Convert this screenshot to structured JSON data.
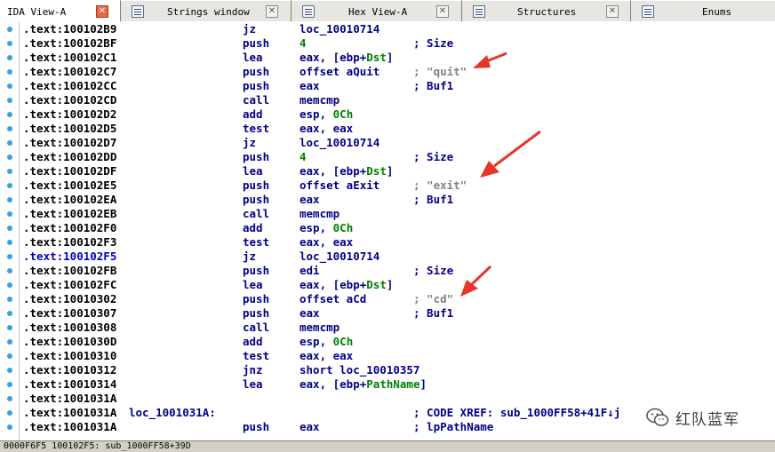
{
  "tabs": [
    {
      "label": "IDA View-A",
      "icon": "listing-icon",
      "active": true
    },
    {
      "label": "Strings window",
      "icon": "strings-icon",
      "active": false
    },
    {
      "label": "Hex View-A",
      "icon": "hex-icon",
      "active": false
    },
    {
      "label": "Structures",
      "icon": "structures-icon",
      "active": false
    },
    {
      "label": "Enums",
      "icon": "enums-icon",
      "active": false
    }
  ],
  "listing": [
    {
      "addr": ".text:100102B9",
      "mnem": "jz",
      "ops": "loc_10010714",
      "cmt": ""
    },
    {
      "addr": ".text:100102BF",
      "mnem": "push",
      "ops": "4",
      "cmt": "; Size"
    },
    {
      "addr": ".text:100102C1",
      "mnem": "lea",
      "ops": "eax, [ebp+Dst]",
      "cmt": ""
    },
    {
      "addr": ".text:100102C7",
      "mnem": "push",
      "ops": "offset aQuit",
      "cmt": "; \"quit\""
    },
    {
      "addr": ".text:100102CC",
      "mnem": "push",
      "ops": "eax",
      "cmt": "; Buf1"
    },
    {
      "addr": ".text:100102CD",
      "mnem": "call",
      "ops": "memcmp",
      "cmt": ""
    },
    {
      "addr": ".text:100102D2",
      "mnem": "add",
      "ops": "esp, 0Ch",
      "cmt": ""
    },
    {
      "addr": ".text:100102D5",
      "mnem": "test",
      "ops": "eax, eax",
      "cmt": ""
    },
    {
      "addr": ".text:100102D7",
      "mnem": "jz",
      "ops": "loc_10010714",
      "cmt": ""
    },
    {
      "addr": ".text:100102DD",
      "mnem": "push",
      "ops": "4",
      "cmt": "; Size"
    },
    {
      "addr": ".text:100102DF",
      "mnem": "lea",
      "ops": "eax, [ebp+Dst]",
      "cmt": ""
    },
    {
      "addr": ".text:100102E5",
      "mnem": "push",
      "ops": "offset aExit",
      "cmt": "; \"exit\""
    },
    {
      "addr": ".text:100102EA",
      "mnem": "push",
      "ops": "eax",
      "cmt": "; Buf1"
    },
    {
      "addr": ".text:100102EB",
      "mnem": "call",
      "ops": "memcmp",
      "cmt": ""
    },
    {
      "addr": ".text:100102F0",
      "mnem": "add",
      "ops": "esp, 0Ch",
      "cmt": ""
    },
    {
      "addr": ".text:100102F3",
      "mnem": "test",
      "ops": "eax, eax",
      "cmt": ""
    },
    {
      "addr": ".text:100102F5",
      "mnem": "jz",
      "ops": "loc_10010714",
      "cmt": "",
      "selected": true
    },
    {
      "addr": ".text:100102FB",
      "mnem": "push",
      "ops": "edi",
      "cmt": "; Size"
    },
    {
      "addr": ".text:100102FC",
      "mnem": "lea",
      "ops": "eax, [ebp+Dst]",
      "cmt": ""
    },
    {
      "addr": ".text:10010302",
      "mnem": "push",
      "ops": "offset aCd",
      "cmt": "; \"cd\""
    },
    {
      "addr": ".text:10010307",
      "mnem": "push",
      "ops": "eax",
      "cmt": "; Buf1"
    },
    {
      "addr": ".text:10010308",
      "mnem": "call",
      "ops": "memcmp",
      "cmt": ""
    },
    {
      "addr": ".text:1001030D",
      "mnem": "add",
      "ops": "esp, 0Ch",
      "cmt": ""
    },
    {
      "addr": ".text:10010310",
      "mnem": "test",
      "ops": "eax, eax",
      "cmt": ""
    },
    {
      "addr": ".text:10010312",
      "mnem": "jnz",
      "ops": "short loc_10010357",
      "cmt": ""
    },
    {
      "addr": ".text:10010314",
      "mnem": "lea",
      "ops": "eax, [ebp+PathName]",
      "cmt": ""
    },
    {
      "addr": ".text:1001031A",
      "mnem": "",
      "ops": "",
      "cmt": ""
    },
    {
      "addr": ".text:1001031A",
      "label": "loc_1001031A:",
      "mnem": "",
      "ops": "",
      "cmt": "; CODE XREF: sub_1000FF58+41F↓j"
    },
    {
      "addr": ".text:1001031A",
      "mnem": "push",
      "ops": "eax",
      "cmt": "; lpPathName"
    }
  ],
  "status": "0000F6F5 100102F5: sub_1000FF58+39D",
  "watermark": "红队蓝军",
  "colors": {
    "arrow": "#e8352a",
    "mnemonic": "#00008b",
    "number": "#008000",
    "comment_string": "#808080",
    "gutter_dot": "#3aa0e0",
    "active_close": "#e46a4a"
  }
}
